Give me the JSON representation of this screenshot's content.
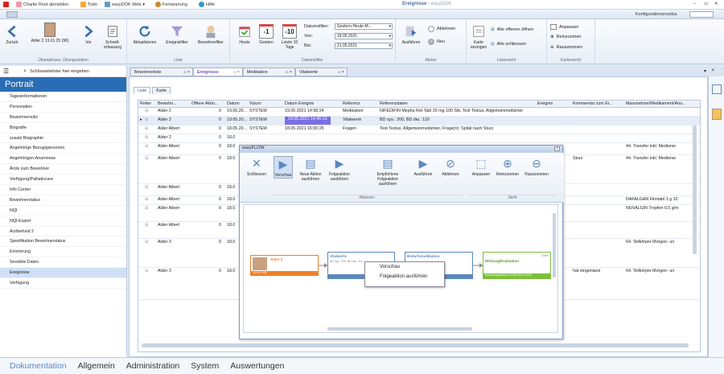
{
  "topbar": {
    "logout": "Charlie Root abmelden",
    "todo": "Todo",
    "easydok": "easyDOK Web",
    "remote": "Fernwartung",
    "help": "Hilfe",
    "app_title": "Ereignisse",
    "app_subtitle": "easyDOK"
  },
  "subbar": {
    "config_mode": "Konfigurationsmodus"
  },
  "ribbon": {
    "back": "Zurück",
    "resident": "Alder 2 13.01.25 (96)",
    "forward": "Vor",
    "quick_capture": "Schnell- erfassung",
    "group_nav": "Übungshaus, Übungsstation",
    "refresh": "Aktualisieren",
    "event_filter": "Ereignisfilter",
    "resident_filter": "Bewohnerfilter",
    "group_list": "Liste",
    "today": "Heute",
    "yesterday": "Gestern",
    "last10": "Letzte 10 Tage",
    "day_minus1": "-1",
    "day_minus10": "-10",
    "date_filter_label": "Datumsfilter:",
    "date_filter_value": "Gestern-Heute-M...",
    "from_label": "Von:",
    "from_value": "18.05.2021",
    "to_label": "Bis:",
    "to_value": "21.05.2021",
    "group_date": "Datumsfilter",
    "execute": "Ausführen",
    "reject": "Ablehnen",
    "new": "Neu",
    "group_action": "Aktion",
    "show_card": "Karte anzeigen",
    "all_open": "Alle offenen öffnen",
    "all_close": "Alle schliessen",
    "group_listview": "Listensicht",
    "fit": "Anpassen",
    "zoom_in": "Reinzoomen",
    "zoom_out": "Rauszoomen",
    "group_cardview": "Kartensicht"
  },
  "sidebar": {
    "search_placeholder": "Schlüsselwörter hier eingeben",
    "title": "Portrait",
    "items": [
      "Tagesinformationen",
      "Personalien",
      "Bewohnernotiz",
      "Biografie",
      "zusatz Biographie",
      "Angehörige Bezugspersonen",
      "Angehörigen-Anamnese",
      "Ärzte zum Bewohner",
      "Verfügung/Palliativcare",
      "Info Center",
      "Bewohnerstatus",
      "NQI",
      "NQI-Export",
      "Arztbefund 2",
      "Spezifikation Bewohnerstatus",
      "Erinnerung",
      "Sensible Daten",
      "Ereignisse",
      "Verfügung"
    ],
    "active_index": 17
  },
  "bottomnav": [
    "Dokumentation",
    "Allgemein",
    "Administration",
    "System",
    "Auswertungen"
  ],
  "doctabs": [
    "Bewohnerliste",
    "Ereignisse",
    "Medikation",
    "Vitalwerte"
  ],
  "innertabs": [
    "Liste",
    "Karte"
  ],
  "grid": {
    "headers": [
      "Reiter",
      "Bewohn...",
      "Offene Aktio...",
      "Datum",
      "Visum",
      "Datum Ereignis",
      "Referenz",
      "Referenzdaten",
      "Ereignis",
      "Kommentar zum Er...",
      "Massnahme/Medikament/Ano..."
    ],
    "rows": [
      [
        "",
        "Alder 2",
        "0",
        "19.05.20...",
        "SYSTEM",
        "19.05.2021 14:58:24",
        "Medikation",
        "NIFEDIFIN Mepha Ret Tabl 20 mg 100 Stk, Test Testus, Allgemeinmediziner",
        "",
        "",
        ""
      ],
      [
        "",
        "Alder 2",
        "0",
        "19.05.20...",
        "SYSTEM",
        "19.05.2021 14:45:13",
        "Vitalwerte",
        "BD sys.: 200, BD dia.: 110",
        "",
        "",
        ""
      ],
      [
        "",
        "Alder Albert",
        "0",
        "18.05.20...",
        "SYSTEM",
        "18.05.2021 16:00:25",
        "Fragen",
        "Test Testus, Allgemeinmediziner, Frage(n): Spital nach Sturz",
        "",
        "",
        ""
      ],
      [
        "",
        "Alder 2",
        "0",
        "18.0",
        "",
        "",
        "",
        "",
        "",
        "",
        ""
      ],
      [
        "",
        "Alder Albert",
        "0",
        "18.0",
        "",
        "",
        "",
        "",
        "",
        "",
        "44. Transfer inkl. Medienw"
      ],
      [
        "",
        "Alder Albert",
        "0",
        "18.0",
        "",
        "",
        "",
        "",
        "",
        "Sturz",
        "44. Transfer inkl. Medienw"
      ],
      [
        "",
        "Alder Albert",
        "0",
        "18.0",
        "",
        "",
        "",
        "",
        "",
        "",
        ""
      ],
      [
        "",
        "Alder Albert",
        "0",
        "18.0",
        "",
        "",
        "",
        "",
        "",
        "",
        "DAFALGAN Filmtabl 1 g 10"
      ],
      [
        "",
        "Alder Albert",
        "0",
        "18.0",
        "",
        "",
        "",
        "",
        "",
        "",
        "NOVALGIN Tropfen 0.5 g/m"
      ],
      [
        "",
        "Alder Albert",
        "0",
        "18.0",
        "",
        "",
        "",
        "",
        "",
        "",
        ""
      ],
      [
        "",
        "Alder 3",
        "0",
        "18.0",
        "",
        "",
        "",
        "",
        "",
        "",
        "64. Teilkörper Morgen- un"
      ],
      [
        "",
        "Alder 3",
        "0",
        "18.0",
        "",
        "",
        "",
        "",
        "",
        "hat eingenässt",
        "64. Teilkörper Morgen- un"
      ]
    ]
  },
  "easyflow": {
    "title": "easyFLOW",
    "buttons": [
      "Schliessen",
      "Vorschau",
      "Neue Aktion ausführen",
      "Folgeaktion ausführen",
      "Empfohlene Folgeaktion ausführen",
      "Ausführen",
      "Ablehnen",
      "Anpassen",
      "Reinzoomen",
      "Rauszoomen"
    ],
    "group_actions": "Aktionen",
    "group_view": "Sicht",
    "nodes": {
      "resident": "Alder 2",
      "resident_date": "13.01.1925",
      "vital": "Vitalwerte",
      "vital_sub": "BD sys.: 200, BD dia.: 110",
      "medication": "Bedarfsmedikation",
      "effect": "Wirkung/Evaluation",
      "effect_sub": "Erinnerungsdatum: 19.05.2021 16:01",
      "effect_tag": "Offen"
    },
    "context": [
      "Vorschau",
      "Folgeaktion ausführen"
    ]
  },
  "colors": {
    "accent": "#2a6db5",
    "highlight": "#7b6ee8",
    "orange": "#ef7f2a",
    "green": "#7cbf3c"
  }
}
